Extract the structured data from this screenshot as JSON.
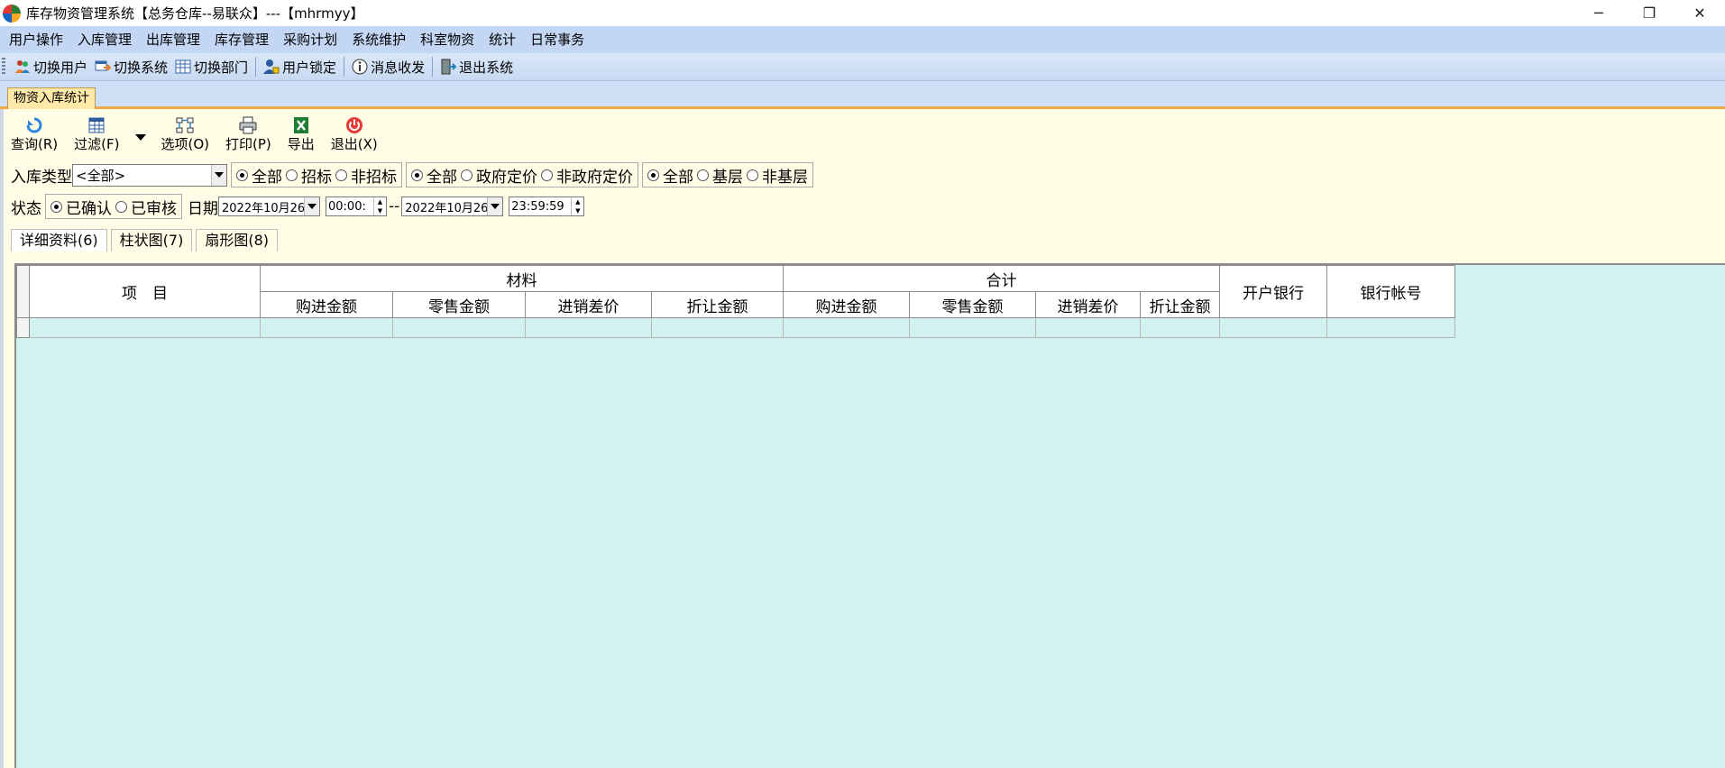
{
  "window": {
    "title": "库存物资管理系统【总务仓库--易联众】---【mhrmyy】",
    "controls": [
      "─",
      "❐",
      "✕"
    ]
  },
  "menu": [
    "用户操作",
    "入库管理",
    "出库管理",
    "库存管理",
    "采购计划",
    "系统维护",
    "科室物资",
    "统计",
    "日常事务"
  ],
  "toolbar": {
    "switch_user": "切换用户",
    "switch_system": "切换系统",
    "switch_dept": "切换部门",
    "lock_user": "用户锁定",
    "messages": "消息收发",
    "exit_system": "退出系统"
  },
  "doc_tab": "物资入库统计",
  "actions": {
    "query": "查询(R)",
    "filter": "过滤(F)",
    "options": "选项(O)",
    "print": "打印(P)",
    "export": "导出",
    "exit": "退出(X)"
  },
  "filters": {
    "in_type_label": "入库类型",
    "in_type_value": "<全部>",
    "bid_group": {
      "all": "全部",
      "bid": "招标",
      "non_bid": "非招标"
    },
    "price_group": {
      "all": "全部",
      "gov": "政府定价",
      "non_gov": "非政府定价"
    },
    "level_group": {
      "all": "全部",
      "base": "基层",
      "non_base": "非基层"
    },
    "status_label": "状态",
    "status_group": {
      "confirmed": "已确认",
      "audited": "已审核"
    },
    "date_label": "日期",
    "date_from": "2022年10月26",
    "time_from": "00:00:",
    "range_sep": "--",
    "date_to": "2022年10月26",
    "time_to": "23:59:59"
  },
  "sub_tabs": [
    "详细资料(6)",
    "柱状图(7)",
    "扇形图(8)"
  ],
  "grid": {
    "item_header": "项　目",
    "group_material": "材料",
    "group_total": "合计",
    "sub_headers": [
      "购进金额",
      "零售金额",
      "进销差价",
      "折让金额"
    ],
    "bank": "开户银行",
    "account": "银行帐号"
  },
  "colors": {
    "menu_bg": "#c3d7f4",
    "content_bg": "#fffde6",
    "grid_bg": "#d2f1f1",
    "tab_accent": "#f0a94a"
  }
}
